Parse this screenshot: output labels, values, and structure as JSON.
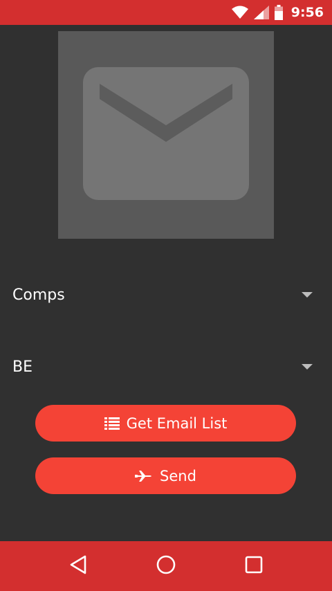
{
  "status_bar": {
    "time": "9:56",
    "icons": [
      "wifi-icon",
      "signal-icon",
      "battery-icon"
    ]
  },
  "hero": {
    "icon": "mail-icon"
  },
  "spinners": [
    {
      "selected": "Comps"
    },
    {
      "selected": "BE"
    }
  ],
  "buttons": {
    "get_email_list": {
      "label": "Get Email List",
      "icon": "list-icon"
    },
    "send": {
      "label": "Send",
      "icon": "plane-icon"
    }
  },
  "nav_bar": {
    "items": [
      "back-icon",
      "home-icon",
      "recents-icon"
    ]
  },
  "colors": {
    "primary_dark": "#d32f2f",
    "accent": "#f44336",
    "background": "#303030"
  }
}
